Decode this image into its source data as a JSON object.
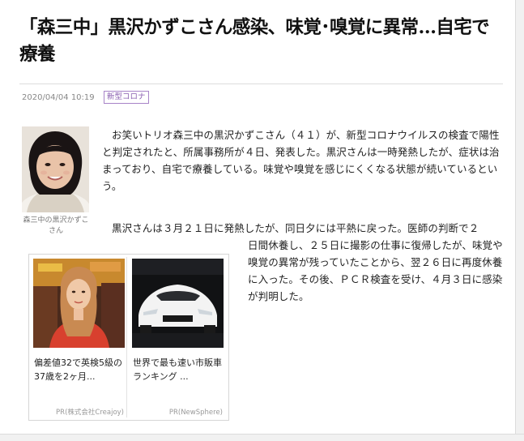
{
  "article": {
    "title": "「森三中」黒沢かずこさん感染、味覚･嗅覚に異常…自宅で療養",
    "date": "2020/04/04 10:19",
    "tag": "新型コロナ",
    "photo_caption": "森三中の黒沢かずこさん",
    "para1": "お笑いトリオ森三中の黒沢かずこさん（４１）が、新型コロナウイルスの検査で陽性と判定されたと、所属事務所が４日、発表した。黒沢さんは一時発熱したが、症状は治まっており、自宅で療養している。味覚や嗅覚を感じにくくなる状態が続いているという。",
    "para2_line1": "黒沢さんは３月２１日に発熱したが、同日夕には平熱に戻った。医師の判断で２",
    "para2_rest": "日間休養し、２５日に撮影の仕事に復帰したが、味覚や嗅覚の異常が残っていたことから、翌２６日に再度休養に入った。その後、ＰＣＲ検査を受け、４月３日に感染が判明した。"
  },
  "ads": [
    {
      "title": "偏差値32で英検5級の37歳を2ヶ月...",
      "source": "PR(株式会社Creajoy)"
    },
    {
      "title": "世界で最も速い市販車ランキング ...",
      "source": "PR(NewSphere)"
    }
  ]
}
